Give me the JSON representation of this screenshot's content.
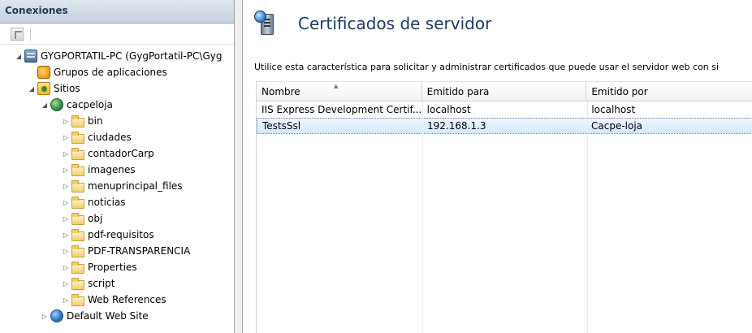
{
  "connections": {
    "header": "Conexiones",
    "tree": [
      {
        "label": "GYGPORTATIL-PC (GygPortatil-PC\\Gyg",
        "icon": "server-icon",
        "level": 0,
        "expander": "◢"
      },
      {
        "label": "Grupos de aplicaciones",
        "icon": "app-pool-icon",
        "level": 1,
        "expander": ""
      },
      {
        "label": "Sitios",
        "icon": "sites-icon",
        "level": 1,
        "expander": "◢"
      },
      {
        "label": "cacpeloja",
        "icon": "globe-icon",
        "level": 2,
        "expander": "◢"
      },
      {
        "label": "bin",
        "icon": "folder-icon",
        "level": 3,
        "expander": "▷"
      },
      {
        "label": "ciudades",
        "icon": "folder-icon",
        "level": 3,
        "expander": "▷"
      },
      {
        "label": "contadorCarp",
        "icon": "folder-icon",
        "level": 3,
        "expander": "▷"
      },
      {
        "label": "imagenes",
        "icon": "folder-icon",
        "level": 3,
        "expander": "▷"
      },
      {
        "label": "menuprincipal_files",
        "icon": "folder-icon",
        "level": 3,
        "expander": "▷"
      },
      {
        "label": "noticias",
        "icon": "folder-icon",
        "level": 3,
        "expander": "▷"
      },
      {
        "label": "obj",
        "icon": "folder-icon",
        "level": 3,
        "expander": "▷"
      },
      {
        "label": "pdf-requisitos",
        "icon": "folder-icon",
        "level": 3,
        "expander": "▷"
      },
      {
        "label": "PDF-TRANSPARENCIA",
        "icon": "folder-icon",
        "level": 3,
        "expander": "▷"
      },
      {
        "label": "Properties",
        "icon": "folder-icon",
        "level": 3,
        "expander": "▷"
      },
      {
        "label": "script",
        "icon": "folder-icon",
        "level": 3,
        "expander": "▷"
      },
      {
        "label": "Web References",
        "icon": "folder-icon",
        "level": 3,
        "expander": "▷"
      },
      {
        "label": "Default Web Site",
        "icon": "default-site-icon",
        "level": 2,
        "expander": "▷"
      }
    ]
  },
  "main": {
    "title": "Certificados de servidor",
    "description": "Utilice esta característica para solicitar y administrar certificados que puede usar el servidor web con si",
    "columns": [
      "Nombre",
      "Emitido para",
      "Emitido por"
    ],
    "rows": [
      {
        "name": "IIS Express Development Certif...",
        "issued_to": "localhost",
        "issued_by": "localhost",
        "selected": false
      },
      {
        "name": "TestsSsl",
        "issued_to": "192.168.1.3",
        "issued_by": "Cacpe-loja",
        "selected": true
      }
    ]
  }
}
